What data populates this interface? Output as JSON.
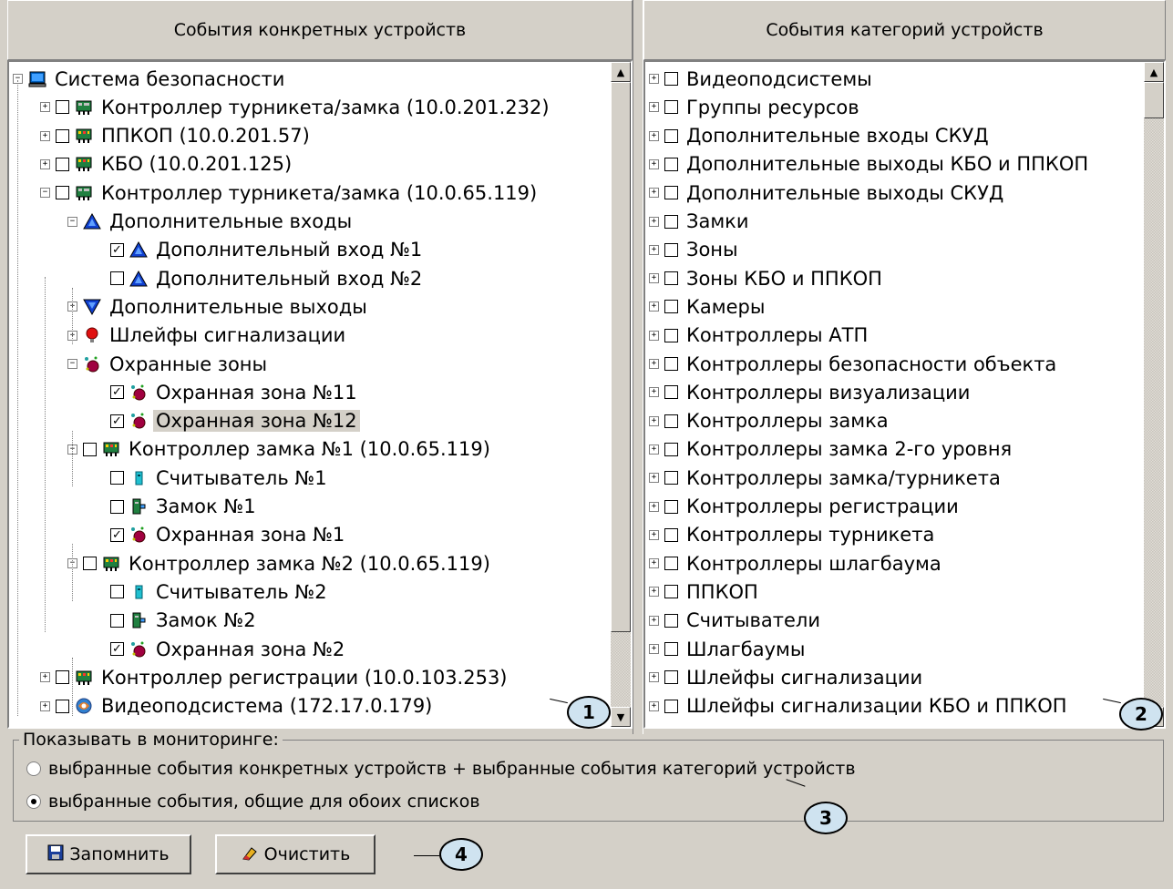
{
  "left_panel": {
    "header": "События конкретных устройств",
    "items": [
      {
        "label": "Система безопасности",
        "level": 0,
        "expander": "minus",
        "checkbox": null,
        "icon": "computer-icon"
      },
      {
        "label": "Контроллер турникета/замка (10.0.201.232)",
        "level": 1,
        "expander": "plus",
        "checkbox": false,
        "icon": "controller-icon"
      },
      {
        "label": "ППКОП (10.0.201.57)",
        "level": 1,
        "expander": "plus",
        "checkbox": false,
        "icon": "panel-icon"
      },
      {
        "label": "КБО (10.0.201.125)",
        "level": 1,
        "expander": "plus",
        "checkbox": false,
        "icon": "panel-icon"
      },
      {
        "label": "Контроллер турникета/замка (10.0.65.119)",
        "level": 1,
        "expander": "minus",
        "checkbox": false,
        "icon": "controller-icon"
      },
      {
        "label": "Дополнительные входы",
        "level": 2,
        "expander": "minus",
        "checkbox": null,
        "icon": "input-triangle-icon"
      },
      {
        "label": "Дополнительный вход №1",
        "level": 3,
        "expander": null,
        "checkbox": true,
        "icon": "input-triangle-icon"
      },
      {
        "label": "Дополнительный вход №2",
        "level": 3,
        "expander": null,
        "checkbox": false,
        "icon": "input-triangle-icon"
      },
      {
        "label": "Дополнительные выходы",
        "level": 2,
        "expander": "plus",
        "checkbox": null,
        "icon": "output-triangle-icon"
      },
      {
        "label": "Шлейфы сигнализации",
        "level": 2,
        "expander": "plus",
        "checkbox": null,
        "icon": "alarm-loop-icon"
      },
      {
        "label": "Охранные зоны",
        "level": 2,
        "expander": "minus",
        "checkbox": null,
        "icon": "security-zone-icon"
      },
      {
        "label": "Охранная зона №11",
        "level": 3,
        "expander": null,
        "checkbox": true,
        "icon": "security-zone-icon"
      },
      {
        "label": "Охранная зона №12",
        "level": 3,
        "expander": null,
        "checkbox": true,
        "icon": "security-zone-icon",
        "selected": true
      },
      {
        "label": "Контроллер замка №1 (10.0.65.119)",
        "level": 2,
        "expander": "minus",
        "checkbox": false,
        "icon": "panel-icon"
      },
      {
        "label": "Считыватель №1",
        "level": 3,
        "expander": null,
        "checkbox": false,
        "icon": "reader-icon"
      },
      {
        "label": "Замок №1",
        "level": 3,
        "expander": null,
        "checkbox": false,
        "icon": "lock-icon"
      },
      {
        "label": "Охранная зона №1",
        "level": 3,
        "expander": null,
        "checkbox": true,
        "icon": "security-zone-icon"
      },
      {
        "label": "Контроллер замка №2 (10.0.65.119)",
        "level": 2,
        "expander": "minus",
        "checkbox": false,
        "icon": "panel-icon"
      },
      {
        "label": "Считыватель №2",
        "level": 3,
        "expander": null,
        "checkbox": false,
        "icon": "reader-icon"
      },
      {
        "label": "Замок №2",
        "level": 3,
        "expander": null,
        "checkbox": false,
        "icon": "lock-icon"
      },
      {
        "label": "Охранная зона №2",
        "level": 3,
        "expander": null,
        "checkbox": true,
        "icon": "security-zone-icon"
      },
      {
        "label": "Контроллер регистрации (10.0.103.253)",
        "level": 1,
        "expander": "plus",
        "checkbox": false,
        "icon": "panel-icon"
      },
      {
        "label": "Видеоподсистема (172.17.0.179)",
        "level": 1,
        "expander": "plus",
        "checkbox": false,
        "icon": "video-subsystem-icon"
      }
    ]
  },
  "right_panel": {
    "header": "События категорий устройств",
    "items": [
      "Видеоподсистемы",
      "Группы ресурсов",
      "Дополнительные входы СКУД",
      "Дополнительные выходы КБО и ППКОП",
      "Дополнительные выходы СКУД",
      "Замки",
      "Зоны",
      "Зоны КБО и ППКОП",
      "Камеры",
      "Контроллеры АТП",
      "Контроллеры безопасности объекта",
      "Контроллеры визуализации",
      "Контроллеры замка",
      "Контроллеры замка 2-го уровня",
      "Контроллеры замка/турникета",
      "Контроллеры регистрации",
      "Контроллеры турникета",
      "Контроллеры шлагбаума",
      "ППКОП",
      "Считыватели",
      "Шлагбаумы",
      "Шлейфы сигнализации",
      "Шлейфы сигнализации КБО и ППКОП"
    ]
  },
  "monitoring": {
    "title": "Показывать в мониторинге:",
    "options": [
      {
        "label": "выбранные события конкретных устройств + выбранные события категорий устройств",
        "selected": false
      },
      {
        "label": "выбранные события, общие для обоих списков",
        "selected": true
      }
    ]
  },
  "buttons": {
    "save_label": "Запомнить",
    "clear_label": "Очистить"
  },
  "callouts": [
    "1",
    "2",
    "3",
    "4"
  ]
}
